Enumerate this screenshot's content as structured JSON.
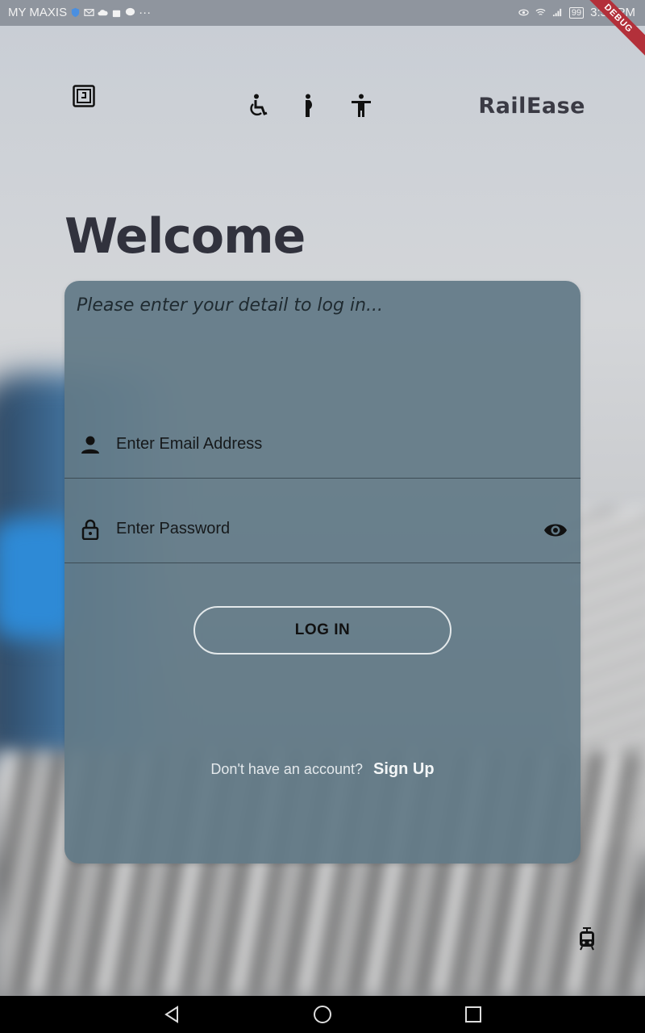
{
  "status_bar": {
    "carrier": "MY MAXIS",
    "battery": "99",
    "time": "3:54 PM",
    "debug_label": "DEBUG"
  },
  "header": {
    "brand": "RailEase",
    "logo_icon": "app-logo-icon",
    "accessibility_icons": [
      "wheelchair-icon",
      "pregnant-icon",
      "accessibility-person-icon"
    ]
  },
  "page": {
    "title": "Welcome"
  },
  "login_card": {
    "subtitle": "Please enter your detail to log in...",
    "email_placeholder": "Enter Email Address",
    "password_placeholder": "Enter Password",
    "login_label": "LOG IN",
    "signup_prompt": "Don't have an account?",
    "signup_link": "Sign Up"
  },
  "colors": {
    "card": "#627a87",
    "title": "#31323d",
    "status_bar": "#8f959e"
  }
}
